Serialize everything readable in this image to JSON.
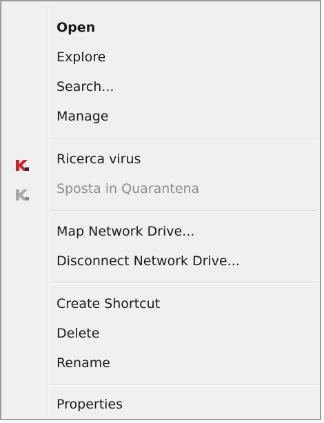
{
  "menu": {
    "items": [
      {
        "label": "Open"
      },
      {
        "label": "Explore"
      },
      {
        "label": "Search..."
      },
      {
        "label": "Manage"
      },
      {
        "label": "Ricerca virus",
        "icon": "kaspersky-icon"
      },
      {
        "label": "Sposta in Quarantena",
        "icon": "kaspersky-disabled-icon"
      },
      {
        "label": "Map Network Drive..."
      },
      {
        "label": "Disconnect Network Drive..."
      },
      {
        "label": "Create Shortcut"
      },
      {
        "label": "Delete"
      },
      {
        "label": "Rename"
      },
      {
        "label": "Properties"
      }
    ]
  },
  "colors": {
    "menu_background": "#f0f0f0",
    "disabled_text": "#8d8d8d",
    "kaspersky_red": "#d4202a"
  }
}
